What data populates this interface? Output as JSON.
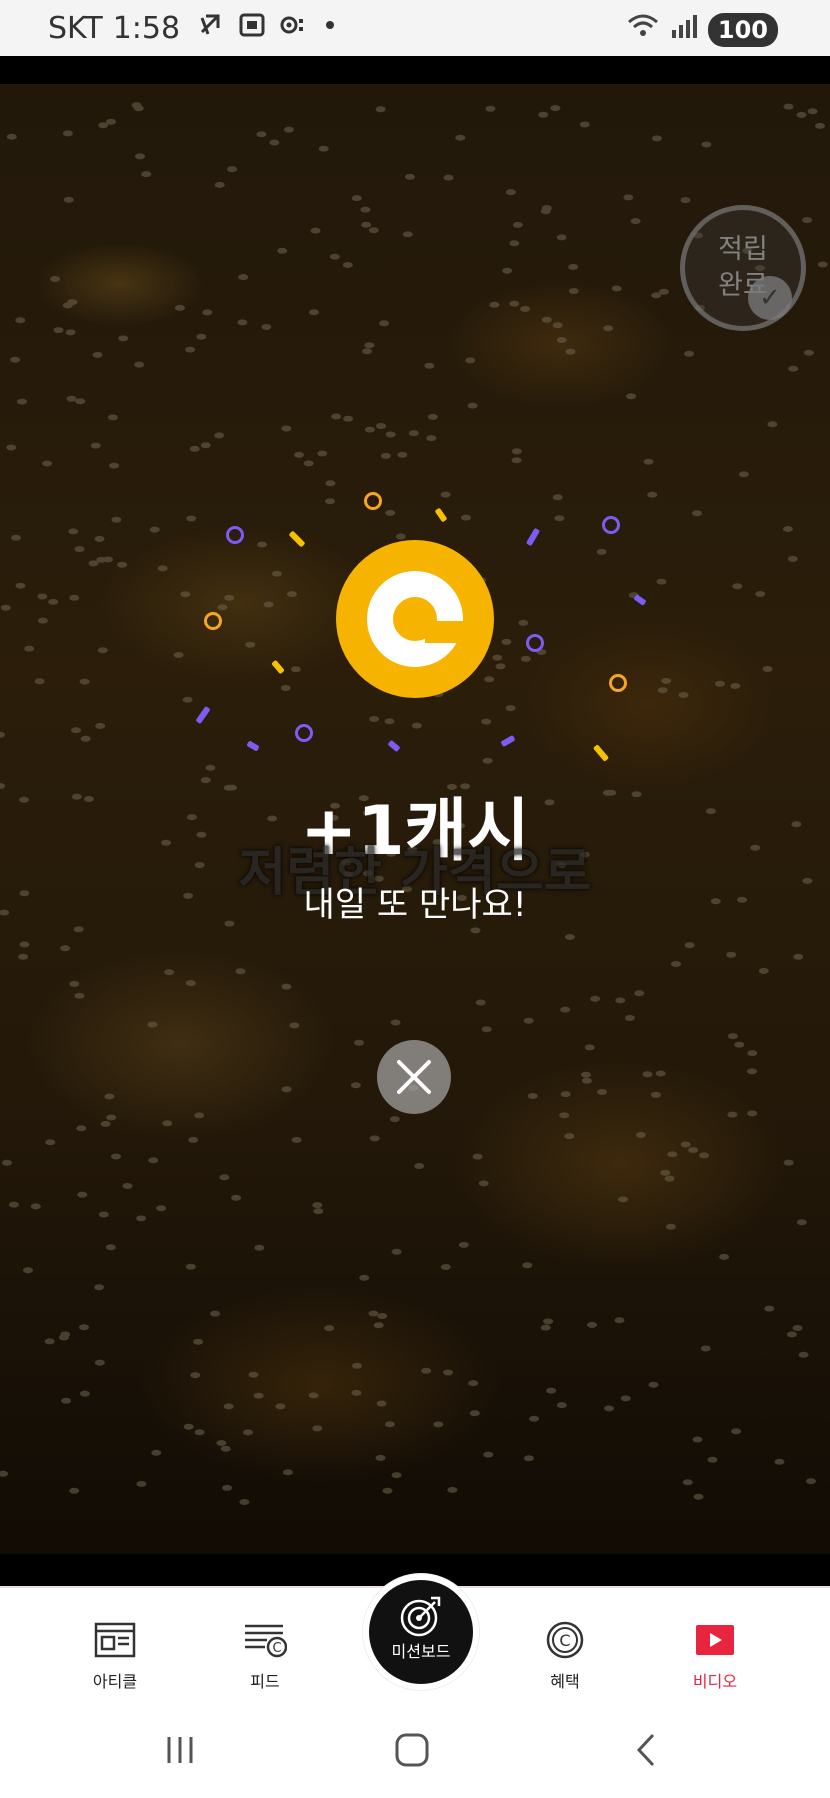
{
  "status_bar": {
    "carrier": "SKT",
    "time": "1:58",
    "battery": "100"
  },
  "reward": {
    "stamp_text": "적립\n완료",
    "amount": "+1캐시",
    "caption_ghost": "저렴한 가격으로",
    "message": "내일 또 만나요!"
  },
  "bottom_nav": {
    "items": [
      {
        "label": "아티클",
        "icon": "article-icon"
      },
      {
        "label": "피드",
        "icon": "feed-icon"
      },
      {
        "label": "미션보드",
        "icon": "mission-target-icon"
      },
      {
        "label": "혜택",
        "icon": "benefit-coin-icon"
      },
      {
        "label": "비디오",
        "icon": "video-play-icon"
      }
    ],
    "active_index": 4,
    "active_color": "#e8253f"
  },
  "colors": {
    "coin": "#f6b400",
    "confetti_ring_purple": "#7d5cf2",
    "confetti_ring_orange": "#f5a623",
    "confetti_bar_yellow": "#f6c200"
  }
}
